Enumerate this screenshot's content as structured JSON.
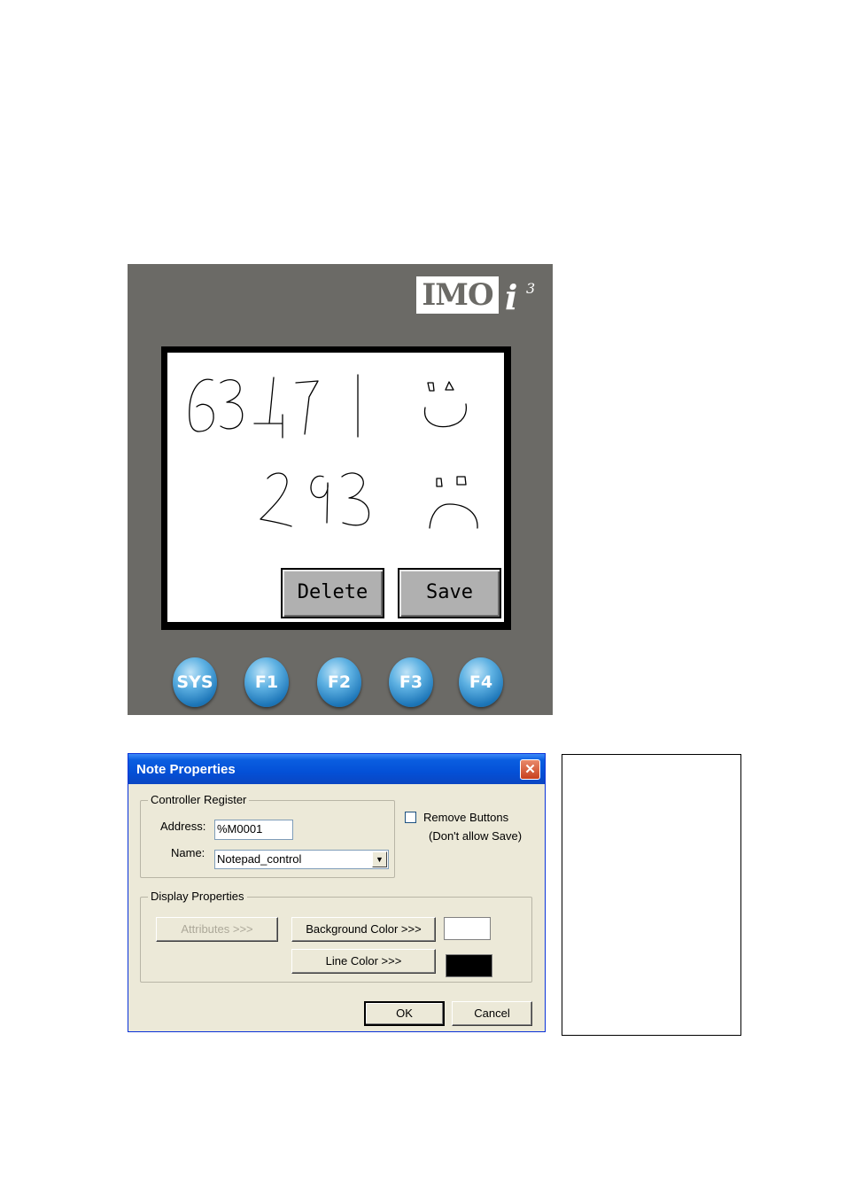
{
  "device": {
    "logo": "IMO",
    "logo_i": "i",
    "logo_sup": "3",
    "screen": {
      "delete_label": "Delete",
      "save_label": "Save"
    },
    "function_keys": [
      "SYS",
      "F1",
      "F2",
      "F3",
      "F4"
    ]
  },
  "dialog": {
    "title": "Note Properties",
    "close_glyph": "✕",
    "controller_register": {
      "legend": "Controller Register",
      "address_label": "Address:",
      "address_value": "%M0001",
      "name_label": "Name:",
      "name_value": "Notepad_control"
    },
    "remove_buttons": {
      "label": "Remove Buttons",
      "note": "(Don't allow Save)",
      "checked": false
    },
    "display_properties": {
      "legend": "Display Properties",
      "attributes_label": "Attributes >>>",
      "background_color_label": "Background Color >>>",
      "line_color_label": "Line Color >>>",
      "background_color": "#ffffff",
      "line_color": "#000000"
    },
    "ok_label": "OK",
    "cancel_label": "Cancel"
  },
  "colors": {
    "device_body": "#6b6a66",
    "function_key": "#1d76b8",
    "title_bar": "#0450d7"
  }
}
